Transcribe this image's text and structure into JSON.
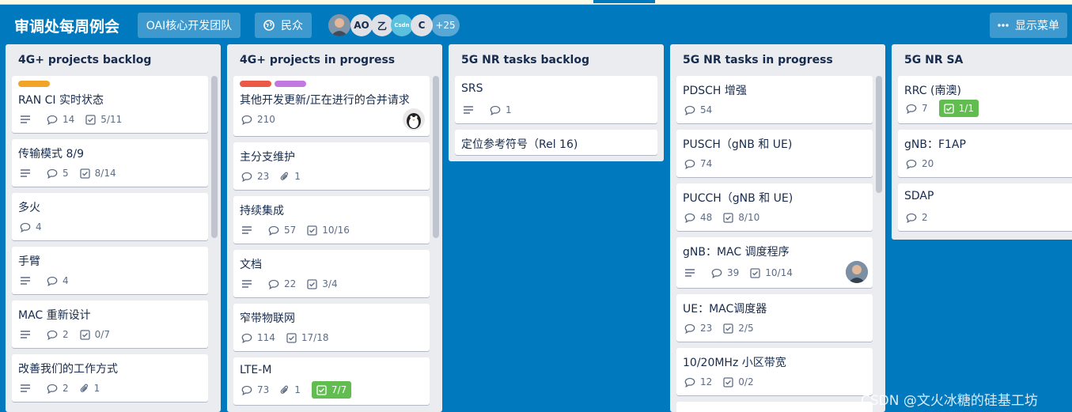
{
  "board": {
    "title": "审调处每周例会",
    "team_button": "OAI核心开发团队",
    "visibility_button": "民众",
    "members": [
      "AO",
      "乙",
      "C",
      "+25"
    ],
    "csdn_avatar_text": "Csdn",
    "menu_button": "显示菜单"
  },
  "colors": {
    "board_bg": "#0079bf",
    "list_bg": "#ebecf0",
    "done_badge": "#61bd4f"
  },
  "lists": [
    {
      "title": "4G+ projects backlog",
      "cards": [
        {
          "label_colors": [
            "#f2a429"
          ],
          "title": "RAN CI 实时状态",
          "comments": "14",
          "checklist": "5/11"
        },
        {
          "title": "传输模式 8/9",
          "comments": "5",
          "checklist": "8/14"
        },
        {
          "title": "多火",
          "comments": "4"
        },
        {
          "title": "手臂",
          "comments": "4"
        },
        {
          "title": "MAC 重新设计",
          "comments": "2",
          "checklist": "0/7"
        },
        {
          "title": "改善我们的工作方式",
          "comments": "2",
          "attachments": "1"
        }
      ]
    },
    {
      "title": "4G+ projects in progress",
      "cards": [
        {
          "label_colors": [
            "#eb5a46",
            "#c377e0"
          ],
          "title": "其他开发更新/正在进行的合并请求",
          "comments": "210"
        },
        {
          "title": "主分支维护",
          "comments": "23",
          "attachments": "1"
        },
        {
          "title": "持续集成",
          "comments": "57",
          "checklist": "10/16"
        },
        {
          "title": "文档",
          "comments": "22",
          "checklist": "3/4"
        },
        {
          "title": "窄带物联网",
          "comments": "114",
          "checklist": "17/18"
        },
        {
          "title": "LTE-M",
          "comments": "73",
          "attachments": "1",
          "checklist_done": "7/7"
        }
      ]
    },
    {
      "title": "5G NR tasks backlog",
      "cards": [
        {
          "title": "SRS",
          "comments": "1"
        },
        {
          "title": "定位参考符号（Rel 16)"
        }
      ]
    },
    {
      "title": "5G NR tasks in progress",
      "cards": [
        {
          "title": "PDSCH 增强",
          "comments": "54"
        },
        {
          "title": "PUSCH（gNB 和 UE)",
          "comments": "74"
        },
        {
          "title": "PUCCH（gNB 和 UE)",
          "comments": "48",
          "checklist": "8/10"
        },
        {
          "title": "gNB：MAC 调度程序",
          "comments": "39",
          "checklist": "10/14"
        },
        {
          "title": "UE：MAC调度器",
          "comments": "23",
          "checklist": "2/5"
        },
        {
          "title": "10/20MHz 小区带宽",
          "comments": "12",
          "checklist": "0/2"
        }
      ]
    },
    {
      "title": "5G NR SA",
      "cards": [
        {
          "title": "RRC (南澳)",
          "comments": "7",
          "checklist_done": "1/1"
        },
        {
          "title": "gNB：F1AP",
          "comments": "20"
        },
        {
          "title": "SDAP",
          "comments": "2"
        }
      ]
    }
  ],
  "watermark": "CSDN @文火冰糖的硅基工坊"
}
